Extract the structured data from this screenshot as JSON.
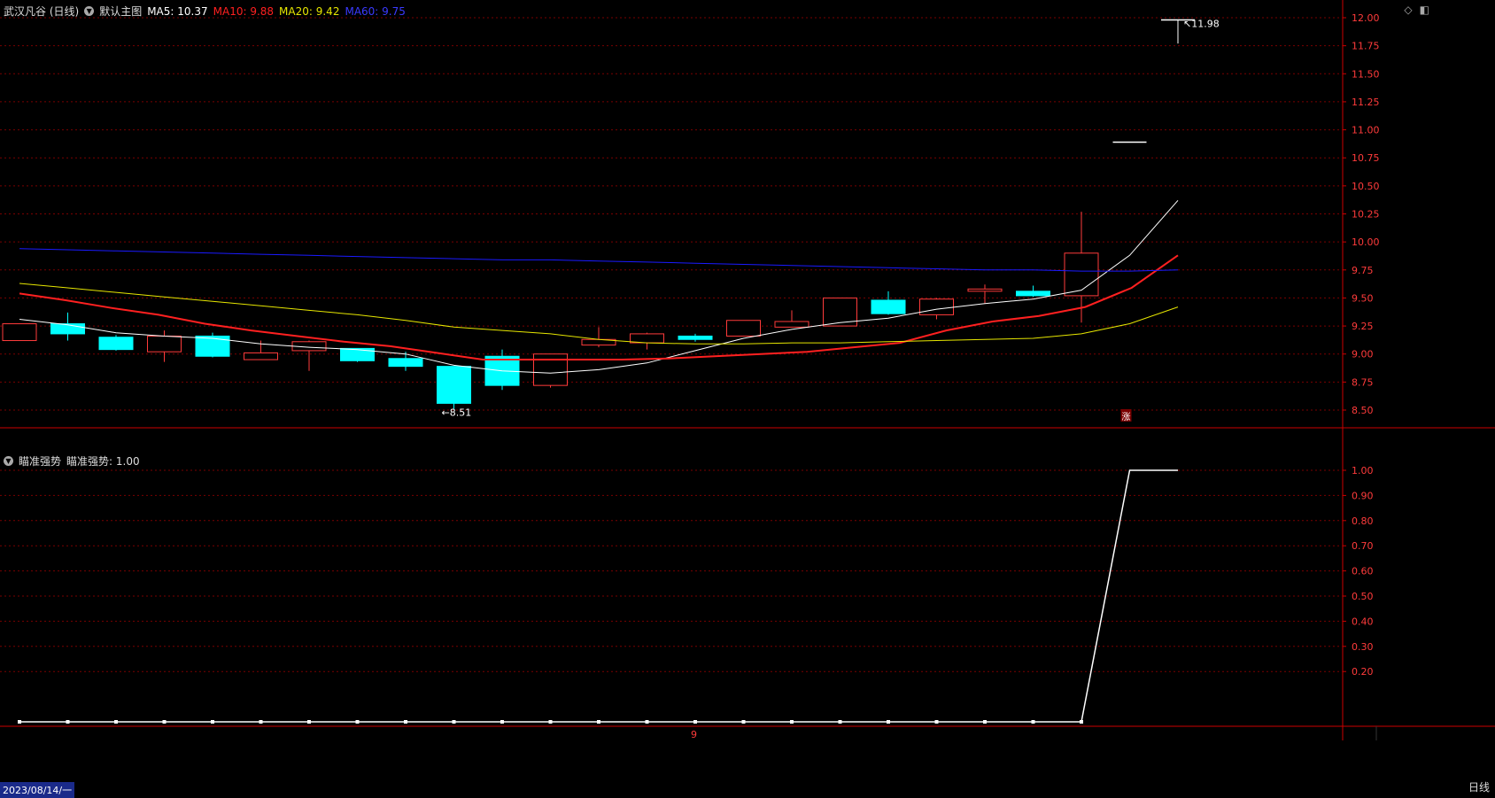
{
  "header": {
    "stock_title": "武汉凡谷 (日线)",
    "main_chart_name": "默认主图",
    "ma5": "MA5: 10.37",
    "ma10": "MA10: 9.88",
    "ma20": "MA20: 9.42",
    "ma60": "MA60: 9.75"
  },
  "sub_header": {
    "indicator_name": "瞄准强势",
    "indicator_value": "瞄准强势: 1.00"
  },
  "footer": {
    "date": "2023/08/14/一",
    "month_marker": "9",
    "period": "日线"
  },
  "zhang_marker": "涨",
  "colors": {
    "up": "#ff3b3b",
    "down": "#00ffff",
    "ma5": "#ffffff",
    "ma10": "#ff2020",
    "ma20": "#e6e600",
    "ma60": "#1a1aff",
    "grid": "#7a0000",
    "axis": "#cc0000"
  },
  "chart_data": [
    {
      "type": "candlestick",
      "title": "武汉凡谷 (日线)",
      "ylim": [
        8.4,
        12.1
      ],
      "ticks": [
        "12.00",
        "11.75",
        "11.50",
        "11.25",
        "11.00",
        "10.75",
        "10.50",
        "10.25",
        "10.00",
        "9.75",
        "9.50",
        "9.25",
        "9.00",
        "8.75",
        "8.50"
      ],
      "annotations": {
        "high": "11.98",
        "low": "8.51"
      },
      "candles": [
        {
          "o": 9.12,
          "h": 9.27,
          "l": 9.12,
          "c": 9.27
        },
        {
          "o": 9.27,
          "h": 9.37,
          "l": 9.12,
          "c": 9.18
        },
        {
          "o": 9.15,
          "h": 9.17,
          "l": 9.03,
          "c": 9.04
        },
        {
          "o": 9.02,
          "h": 9.21,
          "l": 8.93,
          "c": 9.16
        },
        {
          "o": 9.16,
          "h": 9.19,
          "l": 8.97,
          "c": 8.98
        },
        {
          "o": 8.95,
          "h": 9.12,
          "l": 8.95,
          "c": 9.01
        },
        {
          "o": 9.03,
          "h": 9.12,
          "l": 8.85,
          "c": 9.11
        },
        {
          "o": 9.05,
          "h": 9.05,
          "l": 8.93,
          "c": 8.94
        },
        {
          "o": 8.96,
          "h": 9.02,
          "l": 8.85,
          "c": 8.89
        },
        {
          "o": 8.89,
          "h": 8.89,
          "l": 8.51,
          "c": 8.56
        },
        {
          "o": 8.98,
          "h": 9.04,
          "l": 8.68,
          "c": 8.72
        },
        {
          "o": 8.72,
          "h": 9.0,
          "l": 8.7,
          "c": 9.0
        },
        {
          "o": 9.08,
          "h": 9.24,
          "l": 9.06,
          "c": 9.13
        },
        {
          "o": 9.1,
          "h": 9.19,
          "l": 9.04,
          "c": 9.18
        },
        {
          "o": 9.16,
          "h": 9.18,
          "l": 9.11,
          "c": 9.13
        },
        {
          "o": 9.16,
          "h": 9.3,
          "l": 9.16,
          "c": 9.3
        },
        {
          "o": 9.24,
          "h": 9.39,
          "l": 9.24,
          "c": 9.29
        },
        {
          "o": 9.25,
          "h": 9.5,
          "l": 9.25,
          "c": 9.5
        },
        {
          "o": 9.48,
          "h": 9.56,
          "l": 9.35,
          "c": 9.36
        },
        {
          "o": 9.35,
          "h": 9.5,
          "l": 9.31,
          "c": 9.49
        },
        {
          "o": 9.56,
          "h": 9.62,
          "l": 9.45,
          "c": 9.58
        },
        {
          "o": 9.56,
          "h": 9.61,
          "l": 9.51,
          "c": 9.52
        },
        {
          "o": 9.52,
          "h": 10.27,
          "l": 9.28,
          "c": 9.9
        },
        {
          "o": 10.89,
          "h": 10.89,
          "l": 10.89,
          "c": 10.89
        },
        {
          "o": 11.98,
          "h": 11.98,
          "l": 11.77,
          "c": 11.98
        }
      ],
      "series": [
        {
          "name": "MA5",
          "values": [
            9.31,
            9.26,
            9.19,
            9.16,
            9.14,
            9.09,
            9.06,
            9.04,
            9.0,
            8.9,
            8.85,
            8.83,
            8.86,
            8.92,
            9.03,
            9.14,
            9.22,
            9.28,
            9.32,
            9.4,
            9.45,
            9.49,
            9.57,
            9.88,
            10.37
          ]
        },
        {
          "name": "MA10",
          "values": [
            9.54,
            9.48,
            9.41,
            9.35,
            9.27,
            9.21,
            9.16,
            9.11,
            9.07,
            9.01,
            8.95,
            8.95,
            8.95,
            8.95,
            8.96,
            8.98,
            9.0,
            9.02,
            9.06,
            9.1,
            9.21,
            9.29,
            9.34,
            9.42,
            9.59,
            9.88
          ]
        },
        {
          "name": "MA20",
          "values": [
            9.63,
            9.59,
            9.55,
            9.51,
            9.47,
            9.43,
            9.39,
            9.35,
            9.3,
            9.24,
            9.21,
            9.18,
            9.13,
            9.1,
            9.09,
            9.09,
            9.1,
            9.1,
            9.11,
            9.12,
            9.13,
            9.14,
            9.18,
            9.27,
            9.42
          ]
        },
        {
          "name": "MA60",
          "values": [
            9.94,
            9.93,
            9.92,
            9.91,
            9.9,
            9.89,
            9.88,
            9.87,
            9.86,
            9.85,
            9.84,
            9.84,
            9.83,
            9.82,
            9.81,
            9.8,
            9.79,
            9.78,
            9.77,
            9.76,
            9.75,
            9.75,
            9.74,
            9.74,
            9.75
          ]
        }
      ]
    },
    {
      "type": "line",
      "title": "瞄准强势",
      "ylim": [
        0,
        1.05
      ],
      "ticks": [
        "1.00",
        "0.90",
        "0.80",
        "0.70",
        "0.60",
        "0.50",
        "0.40",
        "0.30",
        "0.20"
      ],
      "series": [
        {
          "name": "瞄准强势",
          "values": [
            0,
            0,
            0,
            0,
            0,
            0,
            0,
            0,
            0,
            0,
            0,
            0,
            0,
            0,
            0,
            0,
            0,
            0,
            0,
            0,
            0,
            0,
            0,
            1,
            1
          ]
        }
      ]
    }
  ]
}
